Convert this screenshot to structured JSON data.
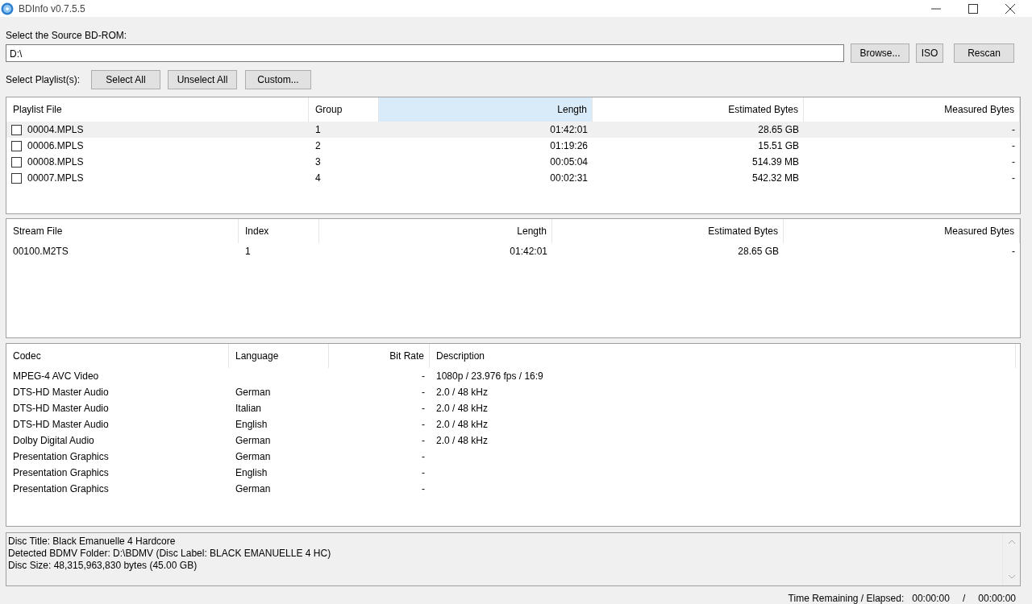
{
  "window": {
    "title": "BDInfo v0.7.5.5"
  },
  "source": {
    "label": "Select the Source BD-ROM:",
    "value": "D:\\",
    "buttons": [
      "Browse...",
      "ISO",
      "Rescan"
    ]
  },
  "playlist_select": {
    "label": "Select Playlist(s):",
    "buttons": [
      "Select All",
      "Unselect All",
      "Custom..."
    ]
  },
  "playlist_table": {
    "columns": [
      {
        "label": "Playlist File",
        "selected": false
      },
      {
        "label": "Group",
        "selected": false
      },
      {
        "label": "Length",
        "selected": true
      },
      {
        "label": "Estimated Bytes",
        "selected": false
      },
      {
        "label": "Measured Bytes",
        "selected": false
      }
    ],
    "rows": [
      {
        "cells": [
          "00004.MPLS",
          "1",
          "01:42:01",
          "28.65 GB",
          "-"
        ],
        "checked": false,
        "selected": true
      },
      {
        "cells": [
          "00006.MPLS",
          "2",
          "01:19:26",
          "15.51 GB",
          "-"
        ],
        "checked": false,
        "selected": false
      },
      {
        "cells": [
          "00008.MPLS",
          "3",
          "00:05:04",
          "514.39 MB",
          "-"
        ],
        "checked": false,
        "selected": false
      },
      {
        "cells": [
          "00007.MPLS",
          "4",
          "00:02:31",
          "542.32 MB",
          "-"
        ],
        "checked": false,
        "selected": false
      }
    ]
  },
  "stream_table": {
    "columns": [
      "Stream File",
      "Index",
      "Length",
      "Estimated Bytes",
      "Measured Bytes"
    ],
    "rows": [
      [
        "00100.M2TS",
        "1",
        "01:42:01",
        "28.65 GB",
        "-"
      ]
    ]
  },
  "codec_table": {
    "columns": [
      "Codec",
      "Language",
      "Bit Rate",
      "Description"
    ],
    "rows": [
      [
        "MPEG-4 AVC Video",
        "",
        "-",
        "1080p / 23.976 fps / 16:9"
      ],
      [
        "DTS-HD Master Audio",
        "German",
        "-",
        "2.0 / 48 kHz"
      ],
      [
        "DTS-HD Master Audio",
        "Italian",
        "-",
        "2.0 / 48 kHz"
      ],
      [
        "DTS-HD Master Audio",
        "English",
        "-",
        "2.0 / 48 kHz"
      ],
      [
        "Dolby Digital Audio",
        "German",
        "-",
        "2.0 / 48 kHz"
      ],
      [
        "Presentation Graphics",
        "German",
        "-",
        ""
      ],
      [
        "Presentation Graphics",
        "English",
        "-",
        ""
      ],
      [
        "Presentation Graphics",
        "German",
        "-",
        ""
      ]
    ]
  },
  "info_lines": [
    "Disc Title: Black Emanuelle 4 Hardcore",
    "Detected BDMV Folder: D:\\BDMV (Disc Label: BLACK EMANUELLE 4 HC)",
    "Disc Size: 48,315,963,830 bytes (45.00 GB)"
  ],
  "status_bar": {
    "label": "Time Remaining / Elapsed:",
    "remaining": "00:00:00",
    "separator": "/",
    "elapsed": "00:00:00"
  }
}
